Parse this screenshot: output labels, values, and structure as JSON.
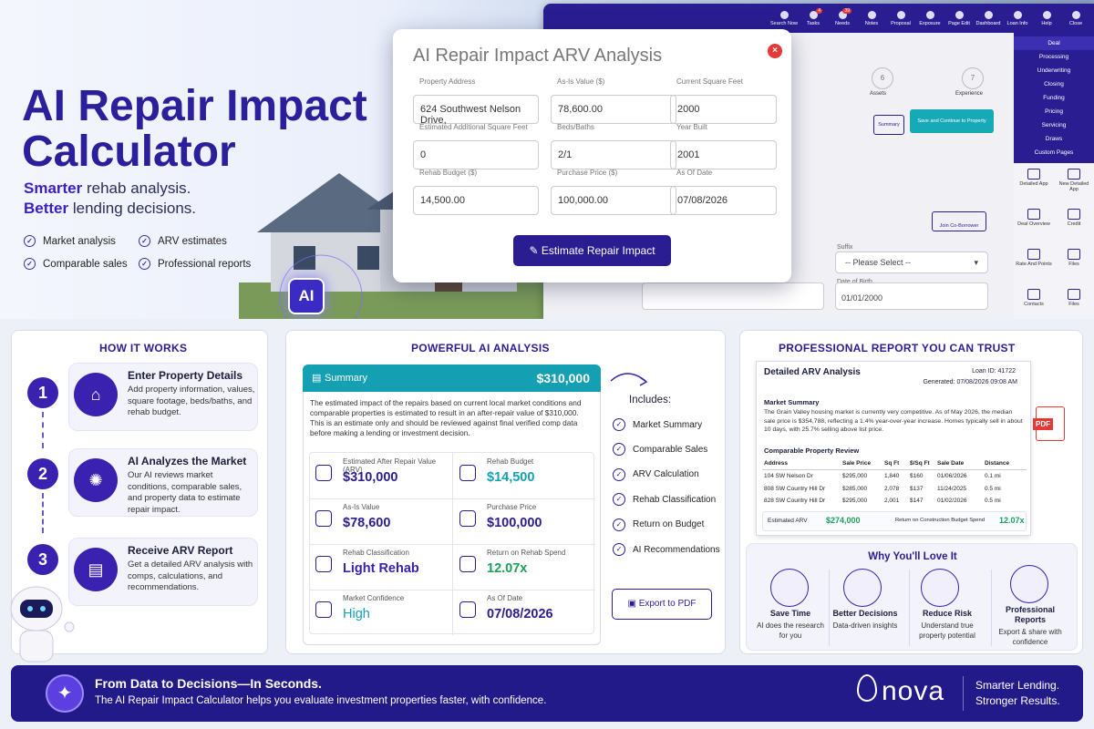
{
  "hero": {
    "title_line1": "AI Repair Impact",
    "title_line2": "Calculator",
    "sub1_bold": "Smarter",
    "sub1_rest": " rehab analysis.",
    "sub2_bold": "Better",
    "sub2_rest": " lending decisions.",
    "features": [
      "Market analysis",
      "ARV estimates",
      "Comparable sales",
      "Professional reports"
    ],
    "ai_badge": "AI"
  },
  "app": {
    "topnav": [
      {
        "label": "Search Now"
      },
      {
        "label": "Tasks",
        "badge": "4"
      },
      {
        "label": "Needs",
        "badge": "39"
      },
      {
        "label": "Notes"
      },
      {
        "label": "Proposal"
      },
      {
        "label": "Exposure"
      },
      {
        "label": "Page Edit"
      },
      {
        "label": "Dashboard"
      },
      {
        "label": "Loan Info"
      },
      {
        "label": "Help"
      },
      {
        "label": "Close"
      }
    ],
    "purple_menu": [
      "Deal",
      "Processing",
      "Underwriting",
      "Closing",
      "Funding",
      "Pricing",
      "Servicing",
      "Draws",
      "Custom Pages"
    ],
    "side_icons": [
      "Detailed App",
      "New Detailed App",
      "Deal Overview",
      "Credit",
      "Rate And Points",
      "Files",
      "Contacts",
      "Files"
    ],
    "steps": [
      {
        "n": "6",
        "label": "Assets"
      },
      {
        "n": "7",
        "label": "Experience"
      }
    ],
    "summary_btn": "Summary",
    "save_btn": "Save and Continue to Property",
    "join_btn": "Join Co-Borrower",
    "suffix_label": "Suffix",
    "suffix_value": "-- Please Select --",
    "dob_label": "Date of Birth",
    "dob_value": "01/01/2000"
  },
  "modal": {
    "title": "AI Repair Impact ARV Analysis",
    "button": "Estimate Repair Impact",
    "fields": [
      {
        "label": "Property Address",
        "value": "624 Southwest Nelson Drive,"
      },
      {
        "label": "As-Is Value ($)",
        "value": "78,600.00"
      },
      {
        "label": "Current Square Feet",
        "value": "2000"
      },
      {
        "label": "Estimated Additional Square Feet",
        "value": "0"
      },
      {
        "label": "Beds/Baths",
        "value": "2/1"
      },
      {
        "label": "Year Built",
        "value": "2001"
      },
      {
        "label": "Rehab Budget ($)",
        "value": "14,500.00"
      },
      {
        "label": "Purchase Price ($)",
        "value": "100,000.00"
      },
      {
        "label": "As Of Date",
        "value": "07/08/2026"
      }
    ]
  },
  "how": {
    "heading": "HOW IT WORKS",
    "steps": [
      {
        "n": "1",
        "title": "Enter Property Details",
        "desc": "Add property information, values, square footage, beds/baths, and rehab budget."
      },
      {
        "n": "2",
        "title": "AI Analyzes the Market",
        "desc": "Our AI reviews market conditions, comparable sales, and property data to estimate repair impact."
      },
      {
        "n": "3",
        "title": "Receive ARV Report",
        "desc": "Get a detailed ARV analysis with comps, calculations, and recommendations."
      }
    ]
  },
  "analysis": {
    "heading": "POWERFUL AI ANALYSIS",
    "summary_label": "Summary",
    "summary_value": "$310,000",
    "summary_text": "The estimated impact of the repairs based on current local market conditions and comparable properties is estimated to result in an after-repair value of $310,000. This is an estimate only and should be reviewed against final verified comp data before making a lending or investment decision.",
    "metrics": [
      {
        "label": "Estimated After Repair Value (ARV)",
        "value": "$310,000"
      },
      {
        "label": "Rehab Budget",
        "value": "$14,500"
      },
      {
        "label": "As-Is Value",
        "value": "$78,600"
      },
      {
        "label": "Purchase Price",
        "value": "$100,000"
      },
      {
        "label": "Rehab Classification",
        "value": "Light Rehab"
      },
      {
        "label": "Return on Rehab Spend",
        "value": "12.07x"
      },
      {
        "label": "Market Confidence",
        "value": "High"
      },
      {
        "label": "As Of Date",
        "value": "07/08/2026"
      }
    ],
    "includes_title": "Includes:",
    "includes": [
      "Market Summary",
      "Comparable Sales",
      "ARV Calculation",
      "Rehab Classification",
      "Return on Budget",
      "AI Recommendations"
    ],
    "export": "Export to PDF"
  },
  "report": {
    "heading": "PROFESSIONAL REPORT YOU CAN TRUST",
    "title": "Detailed ARV Analysis",
    "loan_id": "Loan ID: 41722",
    "generated": "Generated: 07/08/2026 09:08 AM",
    "market_title": "Market Summary",
    "market_text": "The Grain Valley housing market is currently very competitive. As of May 2026, the median sale price is $354,788, reflecting a 1.4% year-over-year increase. Homes typically sell in about 10 days, with 25.7% selling above list price.",
    "comp_title": "Comparable Property Review",
    "columns": [
      "Address",
      "Sale Price",
      "Sq Ft",
      "$/Sq Ft",
      "Sale Date",
      "Distance"
    ],
    "rows": [
      [
        "104 SW Nelson Dr",
        "$295,000",
        "1,840",
        "$160",
        "01/06/2026",
        "0.1 mi"
      ],
      [
        "808 SW Country Hill Dr",
        "$285,000",
        "2,078",
        "$137",
        "11/24/2025",
        "0.5 mi"
      ],
      [
        "828 SW Country Hill Dr",
        "$295,000",
        "2,001",
        "$147",
        "01/02/2026",
        "0.5 mi"
      ]
    ],
    "arv_label": "Estimated ARV",
    "arv_value": "$274,000",
    "ret_label": "Return on Construction Budget Spend",
    "ret_value": "12.07x",
    "pdf": "PDF"
  },
  "why": {
    "heading": "Why You'll Love It",
    "items": [
      {
        "title": "Save Time",
        "desc": "AI does the research for you"
      },
      {
        "title": "Better Decisions",
        "desc": "Data-driven insights"
      },
      {
        "title": "Reduce Risk",
        "desc": "Understand true property potential"
      },
      {
        "title": "Professional Reports",
        "desc": "Export & share with confidence"
      }
    ]
  },
  "banner": {
    "title": "From Data to Decisions—In Seconds.",
    "text": "The AI Repair Impact Calculator helps you evaluate investment properties faster, with confidence.",
    "logo": "nova",
    "tag1": "Smarter Lending.",
    "tag2": "Stronger Results."
  }
}
